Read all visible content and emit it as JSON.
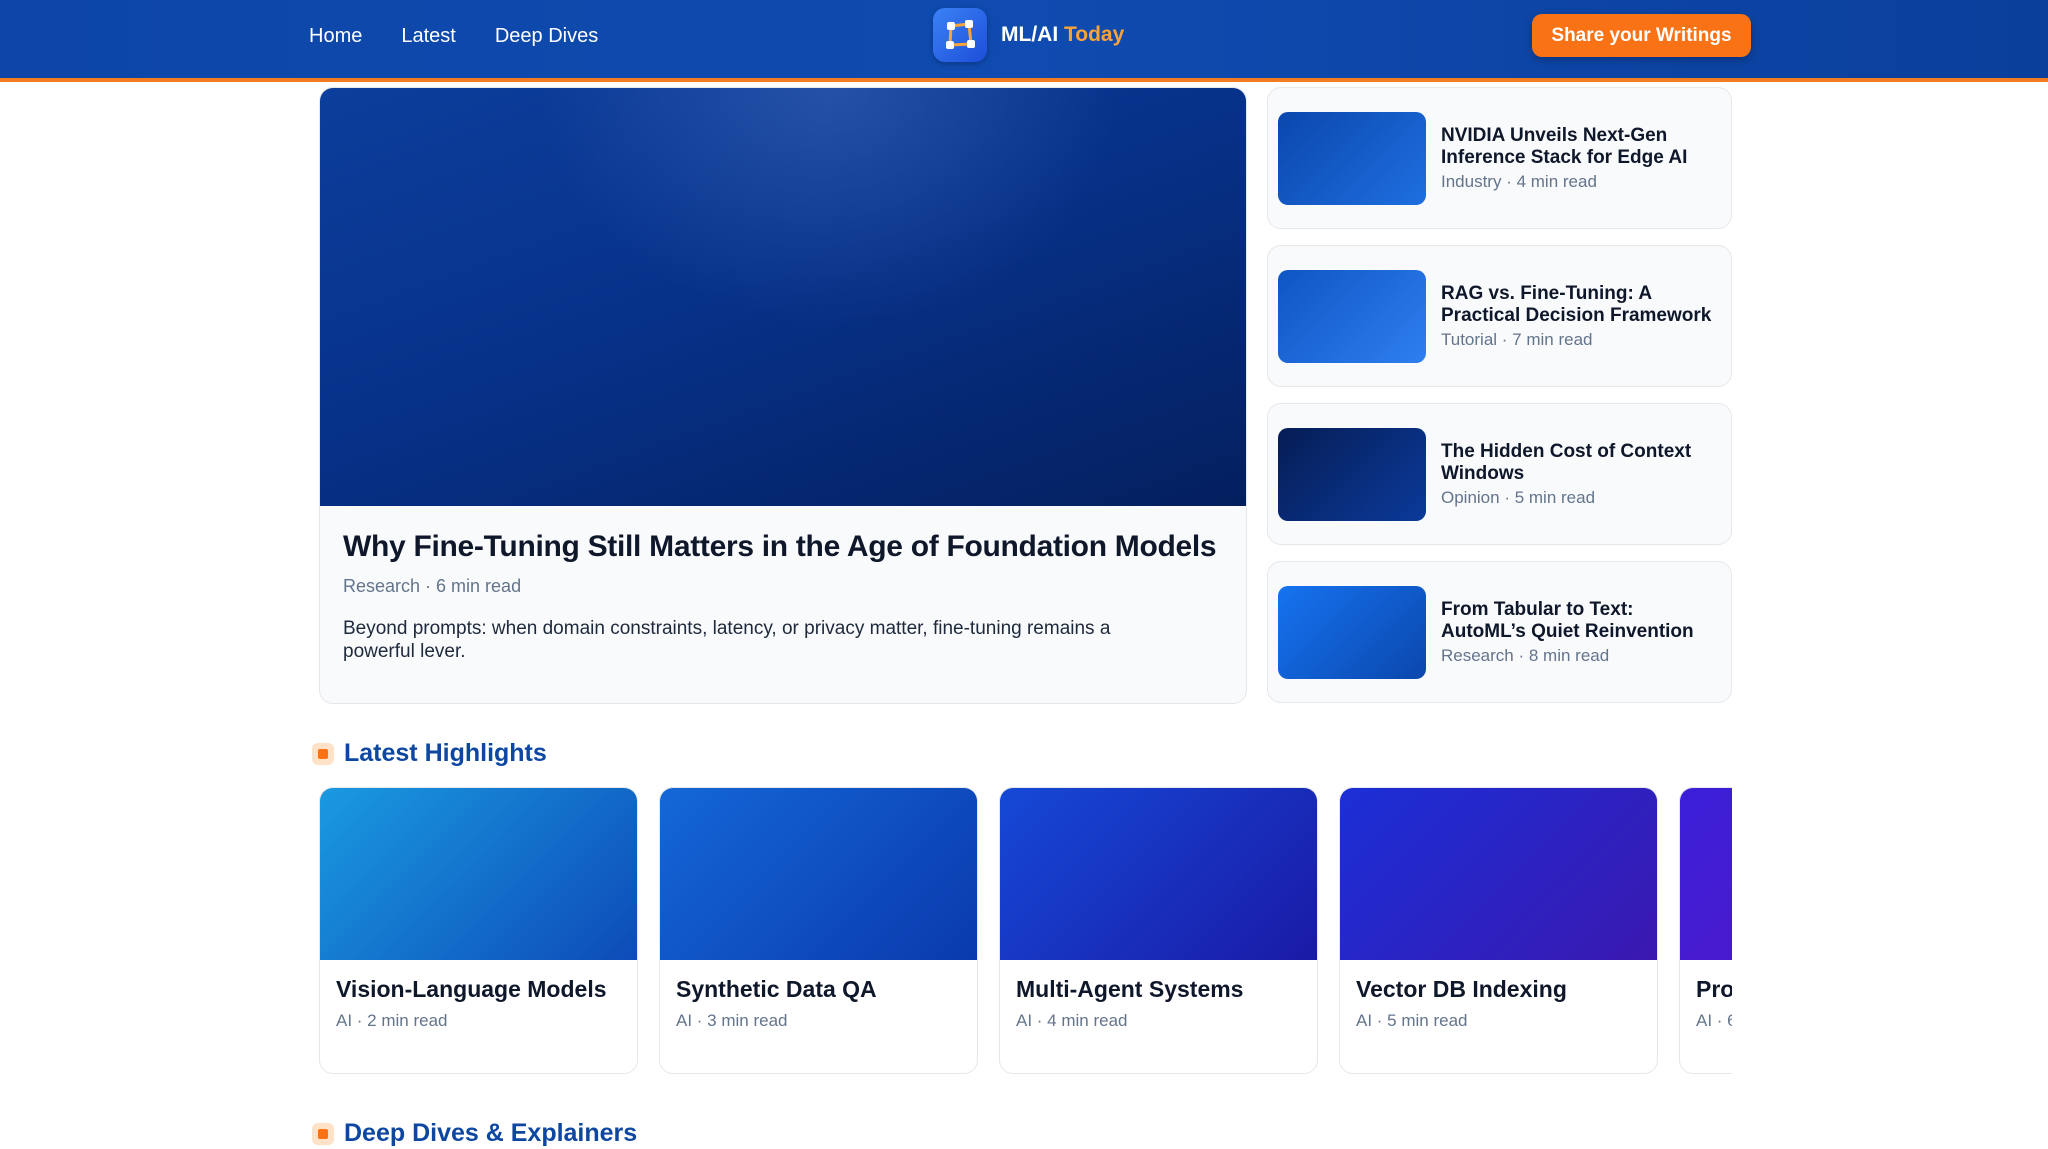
{
  "nav": {
    "home": "Home",
    "latest": "Latest",
    "deep_dives": "Deep Dives"
  },
  "brand": {
    "name": "ML/AI",
    "accent": "Today",
    "logo_icon": "vector-nodes-icon"
  },
  "header": {
    "cta_label": "Share your Writings"
  },
  "hero": {
    "title": "Why Fine-Tuning Still Matters in the Age of Foundation Models",
    "meta": "Research · 6 min read",
    "description": "Beyond prompts: when domain constraints, latency, or privacy matter, fine-tuning remains a powerful lever."
  },
  "side_articles": [
    {
      "title": "NVIDIA Unveils Next-Gen Inference Stack for Edge AI",
      "meta": "Industry · 4 min read"
    },
    {
      "title": "RAG vs. Fine-Tuning: A Practical Decision Framework",
      "meta": "Tutorial · 7 min read"
    },
    {
      "title": "The Hidden Cost of Context Windows",
      "meta": "Opinion · 5 min read"
    },
    {
      "title": "From Tabular to Text: AutoML’s Quiet Reinvention",
      "meta": "Research · 8 min read"
    }
  ],
  "sections": {
    "latest": "Latest Highlights",
    "deep_dives": "Deep Dives & Explainers"
  },
  "highlights": [
    {
      "title": "Vision-Language Models",
      "meta": "AI · 2 min read"
    },
    {
      "title": "Synthetic Data QA",
      "meta": "AI · 3 min read"
    },
    {
      "title": "Multi-Agent Systems",
      "meta": "AI · 4 min read"
    },
    {
      "title": "Vector DB Indexing",
      "meta": "AI · 5 min read"
    },
    {
      "title": "Pro",
      "meta": "AI · 6"
    }
  ],
  "colors": {
    "header": "#0d46a8",
    "accent": "#f97316",
    "section_title": "#0d47a1"
  }
}
